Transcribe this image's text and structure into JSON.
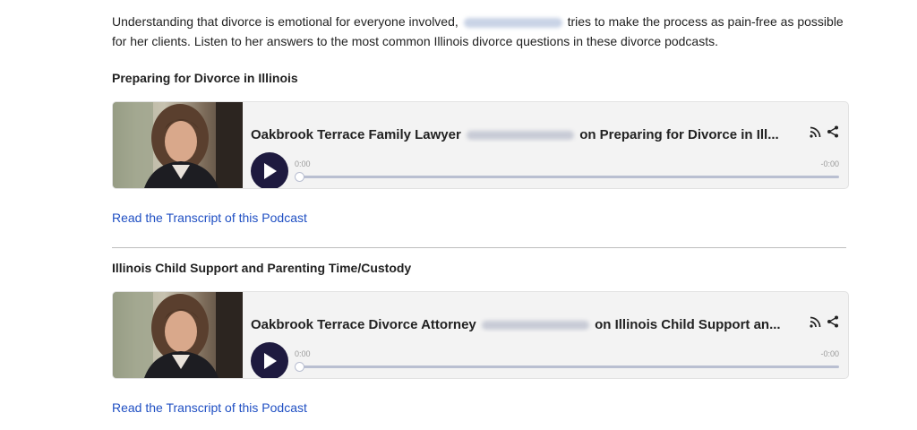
{
  "intro": {
    "before": "Understanding that divorce is emotional for everyone involved,",
    "after": "tries to make the process as pain-free as possible for her clients. Listen to her answers to the most common Illinois divorce questions in these divorce podcasts."
  },
  "podcasts": [
    {
      "heading": "Preparing for Divorce in Illinois",
      "title_before": "Oakbrook Terrace Family Lawyer",
      "title_after": "on Preparing for Divorce in Ill...",
      "time_current": "0:00",
      "time_remaining": "-0:00",
      "progress": 0,
      "link": "Read the Transcript of this Podcast"
    },
    {
      "heading": "Illinois Child Support and Parenting Time/Custody",
      "title_before": "Oakbrook Terrace Divorce Attorney",
      "title_after": "on Illinois Child Support an...",
      "time_current": "0:00",
      "time_remaining": "-0:00",
      "progress": 0,
      "link": "Read the Transcript of this Podcast"
    }
  ],
  "icons": {
    "rss": "rss-icon",
    "share": "share-icon",
    "play": "play-icon"
  },
  "colors": {
    "link": "#1f4fc3",
    "play_button": "#1e1a3f",
    "track": "#b9bfd1"
  }
}
